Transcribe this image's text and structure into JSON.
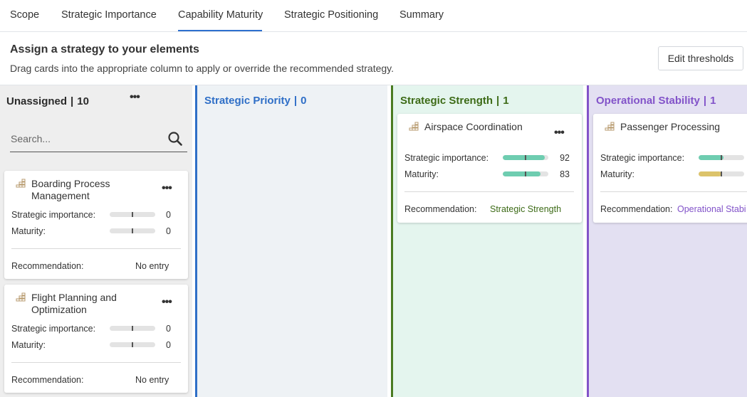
{
  "tabs": [
    {
      "label": "Scope"
    },
    {
      "label": "Strategic Importance"
    },
    {
      "label": "Capability Maturity"
    },
    {
      "label": "Strategic Positioning"
    },
    {
      "label": "Summary"
    }
  ],
  "active_tab": "Capability Maturity",
  "header": {
    "title": "Assign a strategy to your elements",
    "subtitle": "Drag cards into the appropriate column to apply or override the recommended strategy.",
    "edit_thresholds_label": "Edit thresholds"
  },
  "columns": {
    "unassigned": {
      "name": "Unassigned",
      "count": "10",
      "separator": "|"
    },
    "priority": {
      "name": "Strategic Priority",
      "count": "0",
      "separator": "|"
    },
    "strength": {
      "name": "Strategic Strength",
      "count": "1",
      "separator": "|"
    },
    "stability": {
      "name": "Operational Stability",
      "count": "1",
      "separator": "|"
    }
  },
  "search": {
    "placeholder": "Search..."
  },
  "labels": {
    "strategic_importance": "Strategic importance:",
    "maturity": "Maturity:",
    "recommendation": "Recommendation:",
    "menu": "•••"
  },
  "cards": {
    "boarding": {
      "name_line1": "Boarding Process",
      "name_line2": "Management",
      "importance": "0",
      "maturity": "0",
      "recommendation": "No entry",
      "importance_level": 0,
      "maturity_level": 0
    },
    "flight": {
      "name_line1": "Flight Planning and",
      "name_line2": "Optimization",
      "importance": "0",
      "maturity": "0",
      "recommendation": "No entry",
      "importance_level": 0,
      "maturity_level": 0
    },
    "airspace": {
      "name": "Airspace Coordination",
      "importance": "92",
      "maturity": "83",
      "recommendation": "Strategic Strength",
      "importance_level": 92,
      "maturity_level": 83
    },
    "passenger": {
      "name": "Passenger Processing",
      "recommendation": "Operational Stabi",
      "importance_level": 55,
      "maturity_level": 50
    }
  },
  "colors": {
    "tab_accent": "#2d6fce",
    "priority": "#2f6fc7",
    "strength": "#3d6b17",
    "stability": "#8253c9",
    "bar_green": "#6ecdb0",
    "bar_yellow": "#dcc36a",
    "card_icon": "#b79a6d"
  },
  "icons": {
    "search": "search-icon",
    "card": "capability-grid-icon",
    "menu": "more-horizontal-icon"
  }
}
